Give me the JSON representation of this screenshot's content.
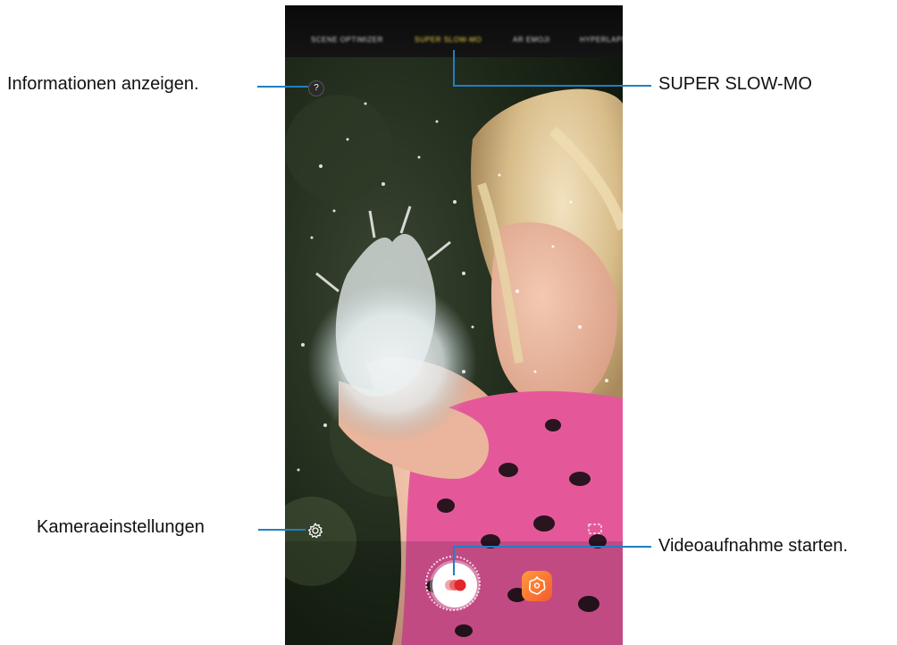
{
  "modes": [
    {
      "label": "SCENE OPTIMIZER",
      "active": false
    },
    {
      "label": "SUPER SLOW-MO",
      "active": true
    },
    {
      "label": "AR EMOJI",
      "active": false
    },
    {
      "label": "HYPERLAPSE",
      "active": false
    }
  ],
  "controls": {
    "help_glyph": "?",
    "help_icon": "question-icon",
    "settings_icon": "gear-icon",
    "frame_icon": "aspect-ratio-icon",
    "record_icon": "super-slow-mo-record-icon",
    "effects_icon": "bixby-vision-icon"
  },
  "callouts": {
    "info": "Informationen anzeigen.",
    "super_slow_mo": "SUPER SLOW-MO",
    "settings": "Kameraeinstellungen",
    "record": "Videoaufnahme starten."
  },
  "colors": {
    "leader_line": "#1f7fc4",
    "active_mode": "#f5d54a",
    "record_dot": "#e3262b",
    "effects_button": "#f7733a"
  }
}
